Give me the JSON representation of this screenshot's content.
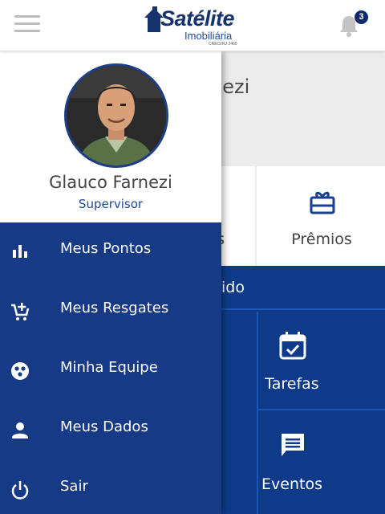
{
  "header": {
    "logo": {
      "name": "Satélite",
      "subtitle": "Imobiliária",
      "creci": "CRECI/RJ 2460"
    },
    "notifications": {
      "count": "3"
    }
  },
  "background": {
    "name_fragment": "nezi",
    "tiles": [
      {
        "label": "s"
      },
      {
        "label": "Prêmios",
        "icon": "gift-card-icon"
      }
    ],
    "strip_text": "ido",
    "cells": [
      {
        "label": "Tarefas",
        "icon": "calendar-check-icon"
      },
      {
        "label": "Eventos",
        "icon": "message-icon"
      }
    ]
  },
  "drawer": {
    "user": {
      "name": "Glauco Farnezi",
      "role": "Supervisor"
    },
    "items": [
      {
        "label": "Meus Pontos",
        "icon": "bar-chart-icon"
      },
      {
        "label": "Meus Resgates",
        "icon": "cart-plus-icon"
      },
      {
        "label": "Minha Equipe",
        "icon": "team-circle-icon"
      },
      {
        "label": "Meus Dados",
        "icon": "person-icon"
      },
      {
        "label": "Sair",
        "icon": "power-icon"
      }
    ]
  },
  "colors": {
    "primary": "#173a86",
    "background_blue": "#0f3a8a",
    "accent_text": "#1f4a9c"
  }
}
